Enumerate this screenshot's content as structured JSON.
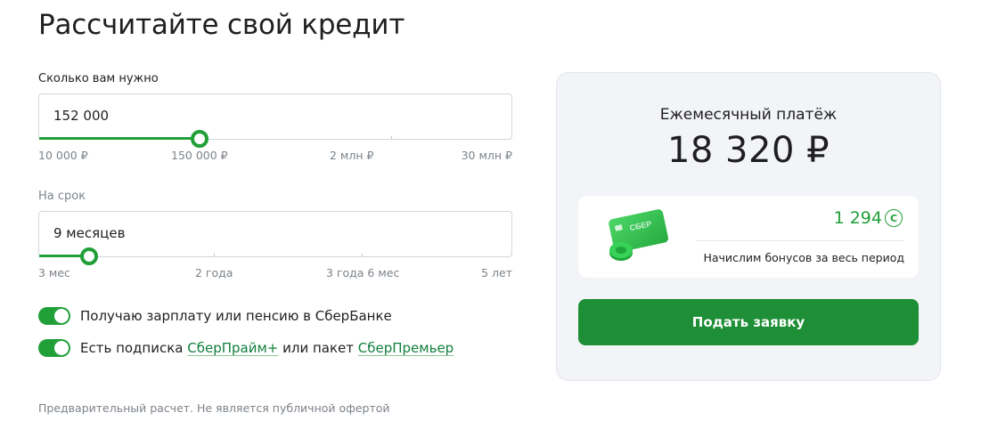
{
  "page": {
    "title": "Рассчитайте свой кредит"
  },
  "amount": {
    "label": "Сколько вам нужно",
    "value": "152 000",
    "slider_fraction": 0.34,
    "scale": [
      "10 000 ₽",
      "150 000 ₽",
      "2 млн ₽",
      "30 млн ₽"
    ]
  },
  "term": {
    "label": "На срок",
    "value": "9 месяцев",
    "slider_fraction": 0.105,
    "scale": [
      "3 мес",
      "2 года",
      "3 года 6 мес",
      "5 лет"
    ]
  },
  "options": {
    "salary": {
      "text": "Получаю зарплату или пенсию в СберБанке",
      "on": true
    },
    "subscription": {
      "prefix": "Есть подписка ",
      "link1": "СберПрайм+",
      "middle": " или пакет ",
      "link2": "СберПремьер",
      "on": true
    }
  },
  "disclaimer": "Предварительный расчет. Не является публичной офертой",
  "summary": {
    "caption": "Ежемесячный платёж",
    "payment": "18 320 ₽",
    "bonus_count": "1 294",
    "bonus_coin_symbol": "C",
    "bonus_note": "Начислим бонусов за весь период",
    "card_logo": "СБЕР",
    "submit_label": "Подать заявку"
  },
  "colors": {
    "accent": "#21a038",
    "button": "#1e8f36",
    "link": "#107f3c"
  }
}
